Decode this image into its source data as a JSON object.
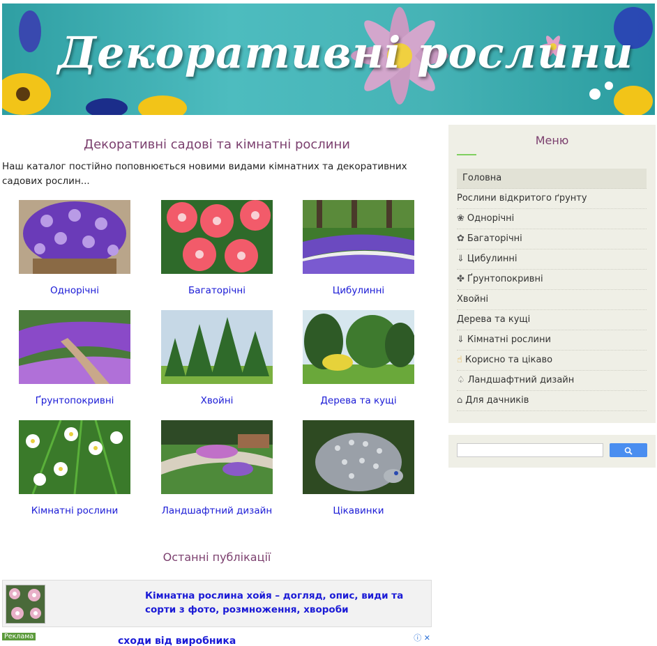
{
  "banner": {
    "title": "Декоративні рослини"
  },
  "main": {
    "heading": "Декоративні садові та кімнатні рослини",
    "intro": "Наш каталог постійно поповнюється новими видами кімнатних та декоративних садових рослин...",
    "categories": [
      {
        "label": "Однорічні"
      },
      {
        "label": "Багаторічні"
      },
      {
        "label": "Цибулинні"
      },
      {
        "label": "Ґрунтопокривні"
      },
      {
        "label": "Хвойні"
      },
      {
        "label": "Дерева та кущі"
      },
      {
        "label": "Кімнатні рослини"
      },
      {
        "label": "Ландшафтний дизайн"
      },
      {
        "label": "Цікавинки"
      }
    ]
  },
  "recent": {
    "heading": "Останні публікації",
    "post_title": "Кімнатна рослина хойя – догляд, опис, види та сорти з фото, розмноження, хвороби"
  },
  "ad": {
    "tag": "Реклама",
    "text": "сходи від виробника"
  },
  "sidebar": {
    "menu_title": "Меню",
    "items": [
      {
        "label": "Головна",
        "icon": ""
      },
      {
        "label": "Рослини відкритого ґрунту",
        "icon": ""
      },
      {
        "label": "Однорічні",
        "icon": "❀"
      },
      {
        "label": "Багаторічні",
        "icon": "✿"
      },
      {
        "label": "Цибулинні",
        "icon": "⇓"
      },
      {
        "label": "Ґрунтопокривні",
        "icon": "✤"
      },
      {
        "label": "Хвойні",
        "icon": ""
      },
      {
        "label": "Дерева та кущі",
        "icon": ""
      },
      {
        "label": "Кімнатні рослини",
        "icon": "⇓"
      },
      {
        "label": "Корисно та цікаво",
        "icon": "☝"
      },
      {
        "label": "Ландшафтний дизайн",
        "icon": "♤"
      },
      {
        "label": "Для дачників",
        "icon": "⌂"
      }
    ]
  },
  "search": {
    "placeholder": "",
    "button_icon": "search-icon"
  },
  "colors": {
    "heading": "#7b3f6e",
    "link": "#1a1ad6",
    "sidebar_bg": "#efefe6",
    "search_button": "#4a8ef0",
    "banner": "#46b3b6"
  }
}
